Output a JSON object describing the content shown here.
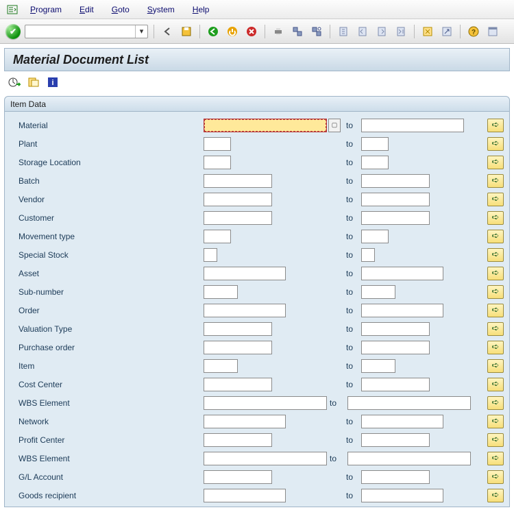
{
  "menu": {
    "items": [
      "Program",
      "Edit",
      "Goto",
      "System",
      "Help"
    ]
  },
  "title": "Material Document List",
  "panel": {
    "title": "Item Data"
  },
  "to_label": "to",
  "fields": [
    {
      "id": "material",
      "label": "Material",
      "w_from": 180,
      "w_to": 150,
      "f4": true,
      "focus": true
    },
    {
      "id": "plant",
      "label": "Plant",
      "w_from": 40,
      "w_to": 40
    },
    {
      "id": "storage-location",
      "label": "Storage Location",
      "w_from": 40,
      "w_to": 40
    },
    {
      "id": "batch",
      "label": "Batch",
      "w_from": 100,
      "w_to": 100
    },
    {
      "id": "vendor",
      "label": "Vendor",
      "w_from": 100,
      "w_to": 100
    },
    {
      "id": "customer",
      "label": "Customer",
      "w_from": 100,
      "w_to": 100
    },
    {
      "id": "movement-type",
      "label": "Movement type",
      "w_from": 40,
      "w_to": 40
    },
    {
      "id": "special-stock",
      "label": "Special Stock",
      "w_from": 20,
      "w_to": 20
    },
    {
      "id": "asset",
      "label": "Asset",
      "w_from": 120,
      "w_to": 120
    },
    {
      "id": "sub-number",
      "label": "Sub-number",
      "w_from": 50,
      "w_to": 50
    },
    {
      "id": "order",
      "label": "Order",
      "w_from": 120,
      "w_to": 120
    },
    {
      "id": "valuation-type",
      "label": "Valuation Type",
      "w_from": 100,
      "w_to": 100
    },
    {
      "id": "purchase-order",
      "label": "Purchase order",
      "w_from": 100,
      "w_to": 100
    },
    {
      "id": "item",
      "label": "Item",
      "w_from": 50,
      "w_to": 50
    },
    {
      "id": "cost-center",
      "label": "Cost Center",
      "w_from": 100,
      "w_to": 100
    },
    {
      "id": "wbs-element-1",
      "label": "WBS Element",
      "w_from": 180,
      "w_to": 180,
      "tight": true
    },
    {
      "id": "network",
      "label": "Network",
      "w_from": 120,
      "w_to": 120
    },
    {
      "id": "profit-center",
      "label": "Profit Center",
      "w_from": 100,
      "w_to": 100
    },
    {
      "id": "wbs-element-2",
      "label": "WBS Element",
      "w_from": 180,
      "w_to": 180,
      "tight": true
    },
    {
      "id": "gl-account",
      "label": "G/L Account",
      "w_from": 100,
      "w_to": 100
    },
    {
      "id": "goods-recipient",
      "label": "Goods recipient",
      "w_from": 120,
      "w_to": 120
    }
  ]
}
